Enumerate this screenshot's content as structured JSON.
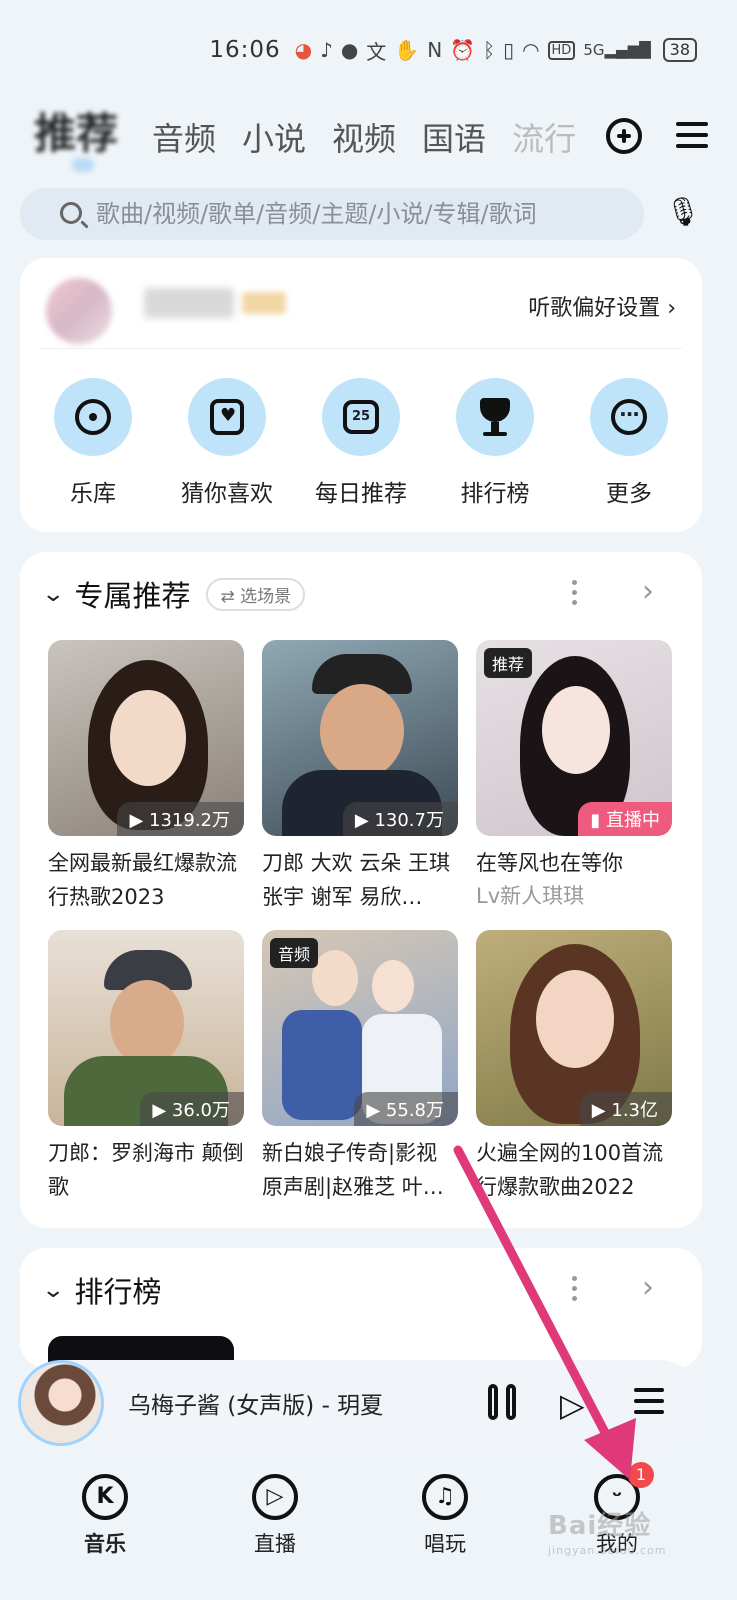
{
  "status_bar": {
    "time": "16:06",
    "battery": "38",
    "icons": [
      "app-icon",
      "tiktok-icon",
      "message-icon",
      "text-icon",
      "hand-icon",
      "nfc-icon",
      "alarm-icon",
      "bluetooth-icon",
      "vibrate-icon",
      "wifi-icon",
      "hd-icon",
      "5g-signal-icon"
    ]
  },
  "top_tabs": {
    "active": "推荐",
    "tabs": [
      "音频",
      "小说",
      "视频",
      "国语",
      "流行"
    ]
  },
  "search": {
    "placeholder": "歌曲/视频/歌单/音频/主题/小说/专辑/歌词"
  },
  "profile": {
    "pref_link": "听歌偏好设置 ›"
  },
  "shortcuts": [
    {
      "label": "乐库",
      "icon": "vinyl-icon"
    },
    {
      "label": "猜你喜欢",
      "icon": "heart-box-icon"
    },
    {
      "label": "每日推荐",
      "icon": "calendar-icon",
      "day": "25"
    },
    {
      "label": "排行榜",
      "icon": "trophy-icon"
    },
    {
      "label": "更多",
      "icon": "more-icon"
    }
  ],
  "recommend": {
    "title": "专属推荐",
    "scene_button": "⇄ 选场景",
    "items": [
      {
        "title": "全网最新最红爆款流行热歌2023",
        "plays": "▶ 1319.2万"
      },
      {
        "title": "刀郎 大欢 云朵 王琪 张宇 谢军 易欣…",
        "plays": "▶ 130.7万"
      },
      {
        "title": "在等风也在等你",
        "sub": "Lv新人琪琪",
        "tag": "推荐",
        "live": "▮ 直播中"
      },
      {
        "title": "刀郎：罗刹海市 颠倒歌",
        "plays": "▶ 36.0万"
      },
      {
        "title": "新白娘子传奇|影视原声剧|赵雅芝 叶…",
        "plays": "▶ 55.8万",
        "tag": "音频"
      },
      {
        "title": "火遍全网的100首流行爆款歌曲2022",
        "plays": "▶ 1.3亿"
      }
    ]
  },
  "charts": {
    "title": "排行榜"
  },
  "player": {
    "title": "乌梅子酱 (女声版) -  玥夏"
  },
  "bottom_nav": [
    {
      "label": "音乐",
      "icon": "music-k-icon",
      "glyph": "K"
    },
    {
      "label": "直播",
      "icon": "live-icon",
      "glyph": "▷"
    },
    {
      "label": "唱玩",
      "icon": "sing-icon",
      "glyph": "♫"
    },
    {
      "label": "我的",
      "icon": "profile-face-icon",
      "glyph": "ᵕ",
      "badge": "1"
    }
  ],
  "watermark": {
    "brand": "Bai经验",
    "url": "jingyan.baidu.com"
  },
  "colors": {
    "accent_light_blue": "#bfe4fa",
    "live_pink": "#ee5b7e",
    "badge_red": "#f04a4a",
    "arrow_pink": "#e0397a"
  }
}
